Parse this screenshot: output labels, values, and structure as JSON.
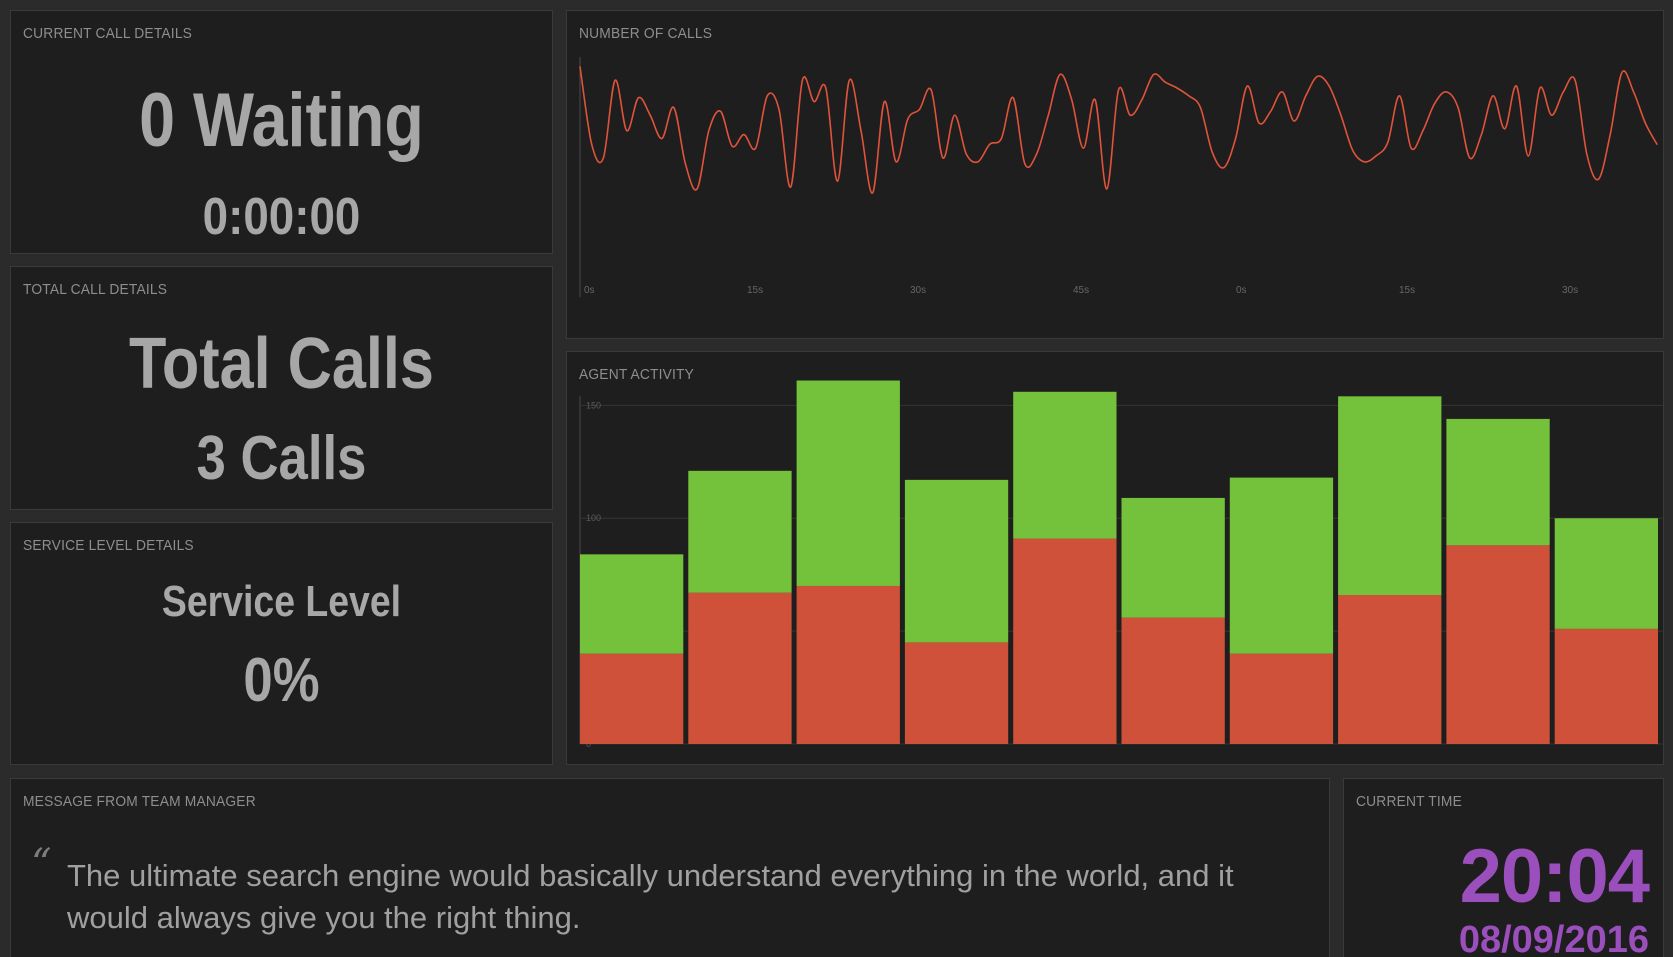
{
  "current_call": {
    "title": "CURRENT CALL DETAILS",
    "waiting": "0 Waiting",
    "timer": "0:00:00"
  },
  "total_call": {
    "title": "TOTAL CALL DETAILS",
    "heading": "Total Calls",
    "value": "3 Calls"
  },
  "service_level": {
    "title": "SERVICE LEVEL DETAILS",
    "heading": "Service Level",
    "value": "0%"
  },
  "number_of_calls": {
    "title": "NUMBER OF CALLS",
    "line_color": "#e0533a"
  },
  "agent_activity": {
    "title": "AGENT ACTIVITY",
    "red_color": "#d0513a",
    "green_color": "#74c23b"
  },
  "message": {
    "title": "MESSAGE FROM TEAM MANAGER",
    "quote_icon": "left-quote-icon",
    "text": "The ultimate search engine would basically understand everything in the world, and it would always give you the right thing."
  },
  "current_time": {
    "title": "CURRENT TIME",
    "time": "20:04",
    "date": "08/09/2016"
  },
  "chart_data": [
    {
      "type": "line",
      "title": "NUMBER OF CALLS",
      "x_tick_labels": [
        "0s",
        "15s",
        "30s",
        "45s",
        "0s",
        "15s",
        "30s"
      ],
      "ylim": [
        0,
        100
      ],
      "grid": false,
      "series": [
        {
          "values": [
            95,
            55,
            48,
            88,
            62,
            79,
            70,
            58,
            74,
            45,
            32,
            62,
            72,
            54,
            60,
            53,
            80,
            73,
            33,
            88,
            77,
            84,
            36,
            88,
            62,
            30,
            77,
            46,
            68,
            73,
            83,
            48,
            70,
            50,
            46,
            55,
            58,
            79,
            45,
            50,
            70,
            91,
            78,
            53,
            78,
            32,
            83,
            70,
            78,
            91,
            87,
            84,
            80,
            74,
            51,
            43,
            58,
            85,
            66,
            72,
            82,
            67,
            80,
            90,
            85,
            70,
            52,
            46,
            49,
            56,
            80,
            53,
            62,
            76,
            82,
            74,
            48,
            60,
            80,
            63,
            85,
            49,
            84,
            70,
            82,
            88,
            50,
            37,
            60,
            92,
            82,
            66,
            55
          ]
        }
      ]
    },
    {
      "type": "bar",
      "title": "AGENT ACTIVITY",
      "stacked": true,
      "y_tick_labels": [
        "0",
        "50",
        "100",
        "150"
      ],
      "ylim": [
        0,
        163
      ],
      "grid": true,
      "series": [
        {
          "color": "red",
          "values": [
            40,
            67,
            70,
            45,
            91,
            56,
            40,
            66,
            88,
            51
          ]
        },
        {
          "color": "green",
          "values": [
            44,
            54,
            91,
            72,
            65,
            53,
            78,
            88,
            56,
            49
          ]
        }
      ]
    }
  ]
}
